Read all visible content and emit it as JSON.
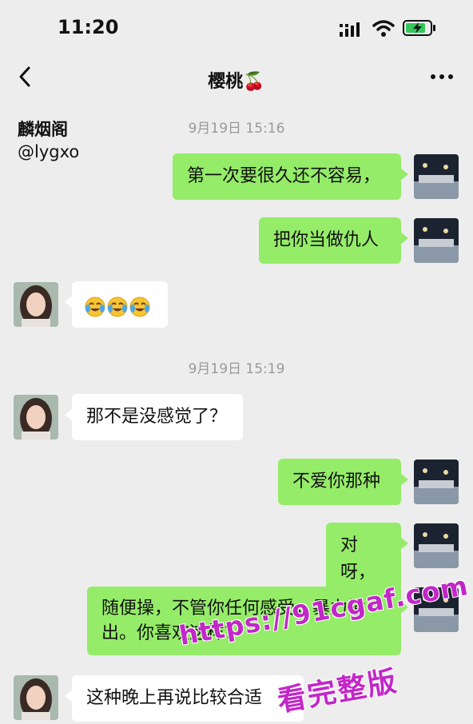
{
  "status_bar": {
    "time": "11:20"
  },
  "nav": {
    "title": "樱桃",
    "title_emoji": "🍒"
  },
  "watermark": {
    "name": "麟烟阁",
    "handle": "@lygxo"
  },
  "messages": [
    {
      "type": "timestamp",
      "text": "9月19日 15:16"
    },
    {
      "type": "sent",
      "text": "第一次要很久还不容易，"
    },
    {
      "type": "sent",
      "text": "把你当做仇人"
    },
    {
      "type": "received",
      "emoji": [
        "face-with-tears-of-joy-icon",
        "face-with-tears-of-joy-icon",
        "face-with-tears-of-joy-icon"
      ]
    },
    {
      "type": "timestamp",
      "text": "9月19日 15:19"
    },
    {
      "type": "received",
      "text": "那不是没感觉了？"
    },
    {
      "type": "sent",
      "text": "不爱你那种"
    },
    {
      "type": "sent",
      "text": "对呀，"
    },
    {
      "type": "sent",
      "text": "随便操，不管你任何感受，暴力输出。你喜欢这样？"
    },
    {
      "type": "received",
      "text": "这种晚上再说比较合适"
    }
  ],
  "overlay": {
    "url": "https://91cgaf.com",
    "cta": "看完整版"
  },
  "colors": {
    "background": "#ededed",
    "sent_bubble": "#95ec69",
    "received_bubble": "#ffffff",
    "overlay": "#c227c8"
  }
}
